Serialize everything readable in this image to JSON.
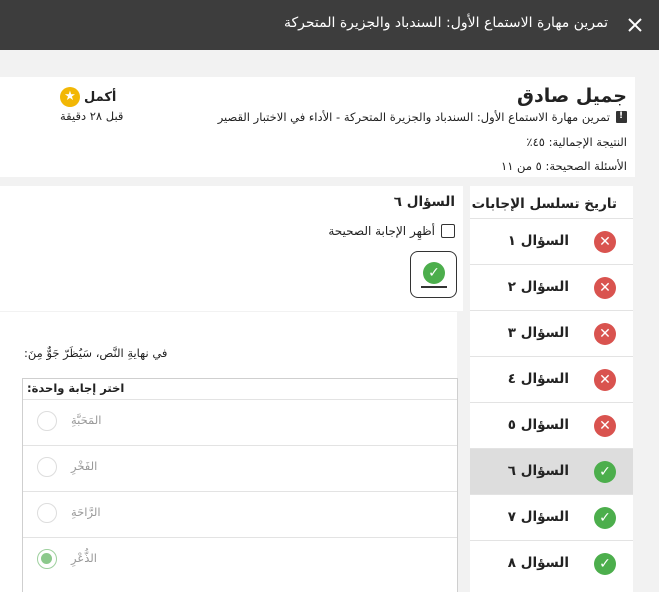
{
  "window": {
    "title": "تمرين مهارة الاستماع الأول: السندباد والجزيرة المتحركة",
    "close_icon": "close-icon"
  },
  "header": {
    "student_name": "جميل صادق",
    "assignment": "تمرين مهارة الاستماع الأول: السندباد والجزيرة المتحركة - الأداء في الاختبار القصير",
    "score": "النتيجة الإجمالية: ٤٥٪",
    "correct": "الأسئلة الصحيحة: ٥ من ١١",
    "status_label": "أكمل",
    "status_time": "قبل ٢٨ دقيقة",
    "status_color": "#f2b705"
  },
  "sidebar": {
    "title": "تاريخ تسلسل الإجابات",
    "items": [
      {
        "label": "السؤال ١",
        "status": "wrong"
      },
      {
        "label": "السؤال ٢",
        "status": "wrong"
      },
      {
        "label": "السؤال ٣",
        "status": "wrong"
      },
      {
        "label": "السؤال ٤",
        "status": "wrong"
      },
      {
        "label": "السؤال ٥",
        "status": "wrong"
      },
      {
        "label": "السؤال ٦",
        "status": "right",
        "selected": true
      },
      {
        "label": "السؤال ٧",
        "status": "right"
      },
      {
        "label": "السؤال ٨",
        "status": "right"
      }
    ]
  },
  "question": {
    "title": "السؤال ٦",
    "show_answer_label": "أظهِر الإجابة الصحيحة",
    "prompt": "في نهايةِ النَّص، سَيُظَرّ جَوٌّ مِنَ:",
    "choices_heading": "اختر إجابة واحدة:",
    "choices": [
      {
        "text": "المَحَبَّةِ",
        "picked": false
      },
      {
        "text": "الفَخْرِ",
        "picked": false
      },
      {
        "text": "الرَّاحَةِ",
        "picked": false
      },
      {
        "text": "الذُّعْرِ",
        "picked": true
      }
    ]
  },
  "colors": {
    "wrong": "#d9534f",
    "right": "#4cae4c",
    "topbar": "#3d3d3d"
  }
}
